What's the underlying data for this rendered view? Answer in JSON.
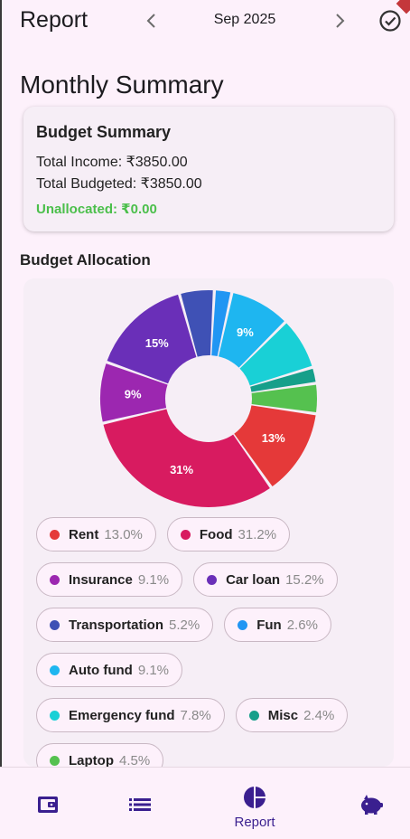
{
  "appbar": {
    "title": "Report",
    "month": "Sep 2025",
    "prev_icon": "chevron-left-icon",
    "next_icon": "chevron-right-icon",
    "action_icon": "check-circle-icon"
  },
  "page": {
    "title": "Monthly Summary"
  },
  "budget_summary": {
    "title": "Budget Summary",
    "total_income": "Total Income: ₹3850.00",
    "total_budgeted": "Total Budgeted: ₹3850.00",
    "unallocated": "Unallocated: ₹0.00",
    "unallocated_color": "#4bbf4b"
  },
  "allocation": {
    "title": "Budget Allocation"
  },
  "chart_data": {
    "type": "pie",
    "title": "",
    "slices": [
      {
        "name": "Rent",
        "value": 13.0,
        "label": "13%",
        "color": "#e53939"
      },
      {
        "name": "Food",
        "value": 31.2,
        "label": "31%",
        "color": "#d81b60"
      },
      {
        "name": "Insurance",
        "value": 9.1,
        "label": "9%",
        "color": "#9c27b0"
      },
      {
        "name": "Car loan",
        "value": 15.2,
        "label": "15%",
        "color": "#6a2fb8"
      },
      {
        "name": "Transportation",
        "value": 5.2,
        "label": "",
        "color": "#3f51b5"
      },
      {
        "name": "Fun",
        "value": 2.6,
        "label": "",
        "color": "#2196f3"
      },
      {
        "name": "Auto fund",
        "value": 9.1,
        "label": "9%",
        "color": "#1eb6f0"
      },
      {
        "name": "Emergency fund",
        "value": 7.8,
        "label": "",
        "color": "#19d0d6"
      },
      {
        "name": "Misc",
        "value": 2.4,
        "label": "",
        "color": "#169f8a"
      },
      {
        "name": "Laptop",
        "value": 4.5,
        "label": "",
        "color": "#55c14f"
      }
    ]
  },
  "legend": [
    {
      "name": "Rent",
      "pct": "13.0%",
      "color": "#e53939"
    },
    {
      "name": "Food",
      "pct": "31.2%",
      "color": "#d81b60"
    },
    {
      "name": "Insurance",
      "pct": "9.1%",
      "color": "#9c27b0"
    },
    {
      "name": "Car loan",
      "pct": "15.2%",
      "color": "#6a2fb8"
    },
    {
      "name": "Transportation",
      "pct": "5.2%",
      "color": "#3f51b5"
    },
    {
      "name": "Fun",
      "pct": "2.6%",
      "color": "#2196f3"
    },
    {
      "name": "Auto fund",
      "pct": "9.1%",
      "color": "#1eb6f0"
    },
    {
      "name": "Emergency fund",
      "pct": "7.8%",
      "color": "#19d0d6"
    },
    {
      "name": "Misc",
      "pct": "2.4%",
      "color": "#169f8a"
    },
    {
      "name": "Laptop",
      "pct": "4.5%",
      "color": "#55c14f"
    }
  ],
  "bottom_nav": {
    "items": [
      {
        "icon": "wallet-icon",
        "label": ""
      },
      {
        "icon": "list-icon",
        "label": ""
      },
      {
        "icon": "pie-chart-icon",
        "label": "Report"
      },
      {
        "icon": "piggy-bank-icon",
        "label": ""
      }
    ],
    "active_color": "#3a1f8f"
  }
}
